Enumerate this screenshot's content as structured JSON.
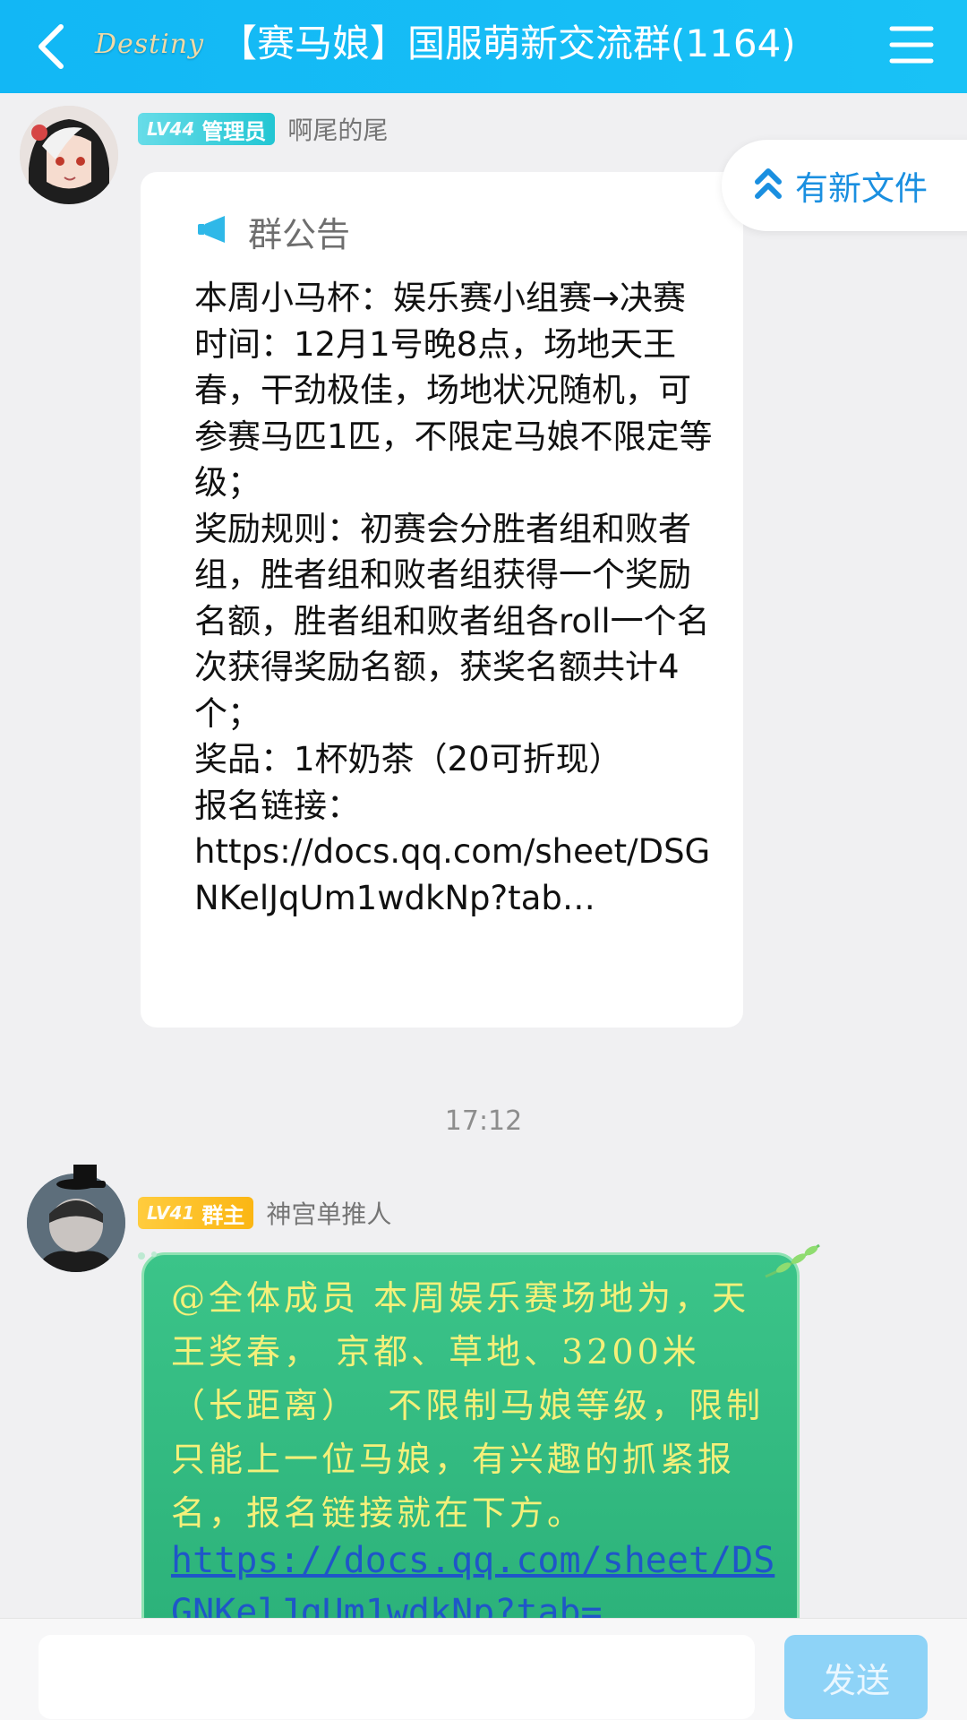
{
  "header": {
    "logo_text": "Destiny",
    "title": "【赛马娘】国服萌新交流群(1164)"
  },
  "messages": [
    {
      "level": "LV44",
      "role": "管理员",
      "sender": "啊尾的尾",
      "announcement": {
        "heading": "群公告",
        "body": "本周小马杯：娱乐赛小组赛→决赛\n时间：12月1号晚8点，场地天王春，干劲极佳，场地状况随机，可参赛马匹1匹，不限定马娘不限定等级；\n奖励规则：初赛会分胜者组和败者组，胜者组和败者组获得一个奖励名额，胜者组和败者组各roll一个名次获得奖励名额，获奖名额共计4个；\n奖品：1杯奶茶（20可折现）\n报名链接：\nhttps://docs.qq.com/sheet/DSGNKelJqUm1wdkNp?tab…"
      }
    },
    {
      "level": "LV41",
      "role": "群主",
      "sender": "神宫单推人",
      "text": "@全体成员 本周娱乐赛场地为，天王奖春， 京都、草地、3200米 （长距离）  不限制马娘等级，限制只能上一位马娘，有兴趣的抓紧报名，报名链接就在下方。",
      "link": "https://docs.qq.com/sheet/DSGNKelJqUm1wdkNp?tab="
    }
  ],
  "timestamp": "17:12",
  "new_file_label": "有新文件",
  "input": {
    "placeholder": ""
  },
  "send_label": "发送",
  "colors": {
    "header_bg": "#12b7f5",
    "admin_badge": "#22c6d3",
    "owner_badge": "#fbb613",
    "green_bubble": "#2cb27a",
    "send_button": "#8ed3f7"
  }
}
